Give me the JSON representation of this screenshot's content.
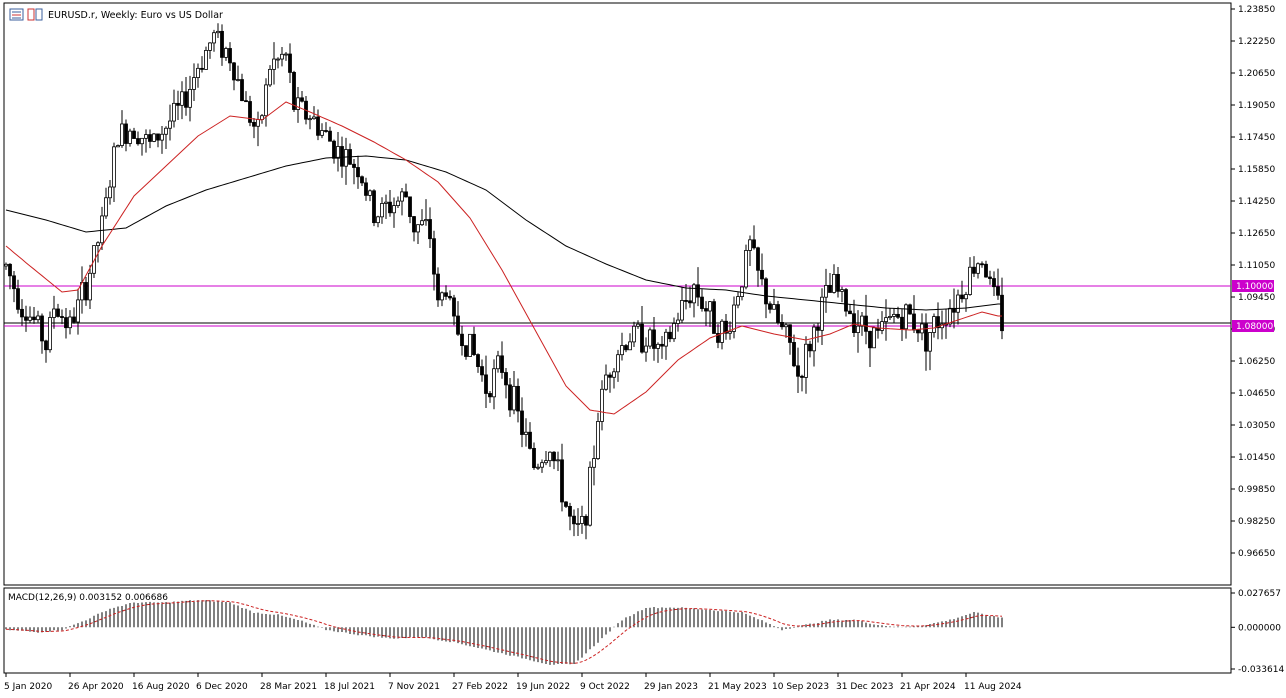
{
  "header": {
    "symbol_line": "EURUSD.r, Weekly:  Euro vs US Dollar"
  },
  "chart_data": [
    {
      "type": "candlestick",
      "title": "EURUSD.r, Weekly:  Euro vs US Dollar",
      "ylim": [
        0.955,
        1.2385
      ],
      "y_ticks": [
        "1.23850",
        "1.22250",
        "1.20650",
        "1.19050",
        "1.17450",
        "1.15850",
        "1.14250",
        "1.12650",
        "1.11050",
        "1.09450",
        "1.07850",
        "1.06250",
        "1.04650",
        "1.03050",
        "1.01450",
        "0.99850",
        "0.98250",
        "0.96650"
      ],
      "x_ticks": [
        {
          "label": "5 Jan 2020",
          "i": 0
        },
        {
          "label": "26 Apr 2020",
          "i": 16
        },
        {
          "label": "16 Aug 2020",
          "i": 32
        },
        {
          "label": "6 Dec 2020",
          "i": 48
        },
        {
          "label": "28 Mar 2021",
          "i": 64
        },
        {
          "label": "18 Jul 2021",
          "i": 80
        },
        {
          "label": "7 Nov 2021",
          "i": 96
        },
        {
          "label": "27 Feb 2022",
          "i": 112
        },
        {
          "label": "19 Jun 2022",
          "i": 128
        },
        {
          "label": "9 Oct 2022",
          "i": 144
        },
        {
          "label": "29 Jan 2023",
          "i": 160
        },
        {
          "label": "21 May 2023",
          "i": 176
        },
        {
          "label": "10 Sep 2023",
          "i": 192
        },
        {
          "label": "31 Dec 2023",
          "i": 208
        },
        {
          "label": "21 Apr 2024",
          "i": 224
        },
        {
          "label": "11 Aug 2024",
          "i": 240
        }
      ],
      "horizontal_levels": [
        {
          "value": 1.1,
          "label": "1.10000",
          "color": "#cc00cc"
        },
        {
          "value": 1.08,
          "label": "1.08000",
          "color": "#cc00cc"
        }
      ],
      "price_line": {
        "value": 1.0815,
        "color": "#000000"
      },
      "anchors": [
        [
          0,
          1.11
        ],
        [
          4,
          1.09
        ],
        [
          8,
          1.08
        ],
        [
          10,
          1.07
        ],
        [
          12,
          1.09
        ],
        [
          16,
          1.08
        ],
        [
          20,
          1.1
        ],
        [
          24,
          1.13
        ],
        [
          28,
          1.175
        ],
        [
          32,
          1.18
        ],
        [
          36,
          1.17
        ],
        [
          40,
          1.18
        ],
        [
          44,
          1.19
        ],
        [
          48,
          1.21
        ],
        [
          52,
          1.225
        ],
        [
          56,
          1.215
        ],
        [
          60,
          1.19
        ],
        [
          63,
          1.175
        ],
        [
          66,
          1.21
        ],
        [
          70,
          1.215
        ],
        [
          72,
          1.19
        ],
        [
          76,
          1.185
        ],
        [
          80,
          1.175
        ],
        [
          84,
          1.165
        ],
        [
          88,
          1.16
        ],
        [
          92,
          1.135
        ],
        [
          96,
          1.14
        ],
        [
          100,
          1.145
        ],
        [
          102,
          1.13
        ],
        [
          104,
          1.13
        ],
        [
          106,
          1.125
        ],
        [
          108,
          1.09
        ],
        [
          110,
          1.1
        ],
        [
          112,
          1.08
        ],
        [
          116,
          1.07
        ],
        [
          120,
          1.05
        ],
        [
          124,
          1.06
        ],
        [
          128,
          1.035
        ],
        [
          132,
          1.01
        ],
        [
          136,
          1.02
        ],
        [
          140,
          0.99
        ],
        [
          142,
          0.975
        ],
        [
          144,
          0.98
        ],
        [
          146,
          1.0
        ],
        [
          148,
          1.035
        ],
        [
          150,
          1.055
        ],
        [
          152,
          1.065
        ],
        [
          156,
          1.075
        ],
        [
          160,
          1.075
        ],
        [
          164,
          1.065
        ],
        [
          168,
          1.085
        ],
        [
          172,
          1.1
        ],
        [
          176,
          1.085
        ],
        [
          180,
          1.075
        ],
        [
          184,
          1.105
        ],
        [
          186,
          1.12
        ],
        [
          188,
          1.105
        ],
        [
          192,
          1.085
        ],
        [
          196,
          1.07
        ],
        [
          198,
          1.055
        ],
        [
          200,
          1.065
        ],
        [
          204,
          1.09
        ],
        [
          207,
          1.1
        ],
        [
          210,
          1.09
        ],
        [
          214,
          1.08
        ],
        [
          218,
          1.075
        ],
        [
          222,
          1.085
        ],
        [
          226,
          1.085
        ],
        [
          230,
          1.075
        ],
        [
          234,
          1.085
        ],
        [
          238,
          1.095
        ],
        [
          242,
          1.11
        ],
        [
          244,
          1.115
        ],
        [
          246,
          1.1
        ],
        [
          248,
          1.09
        ],
        [
          249,
          1.082
        ]
      ],
      "series": [
        {
          "name": "",
          "kind": "moving-average",
          "period": 200,
          "color": "#000000",
          "values": [
            [
              0,
              1.138
            ],
            [
              10,
              1.133
            ],
            [
              20,
              1.127
            ],
            [
              30,
              1.129
            ],
            [
              40,
              1.14
            ],
            [
              50,
              1.148
            ],
            [
              60,
              1.154
            ],
            [
              70,
              1.16
            ],
            [
              80,
              1.164
            ],
            [
              90,
              1.165
            ],
            [
              100,
              1.163
            ],
            [
              110,
              1.157
            ],
            [
              120,
              1.148
            ],
            [
              130,
              1.133
            ],
            [
              140,
              1.12
            ],
            [
              150,
              1.111
            ],
            [
              160,
              1.103
            ],
            [
              170,
              1.099
            ],
            [
              180,
              1.098
            ],
            [
              190,
              1.095
            ],
            [
              200,
              1.093
            ],
            [
              210,
              1.091
            ],
            [
              220,
              1.089
            ],
            [
              230,
              1.088
            ],
            [
              240,
              1.089
            ],
            [
              248,
              1.091
            ]
          ]
        },
        {
          "name": "",
          "kind": "moving-average",
          "period": 50,
          "color": "#cc2222",
          "values": [
            [
              0,
              1.12
            ],
            [
              6,
              1.11
            ],
            [
              14,
              1.097
            ],
            [
              18,
              1.098
            ],
            [
              24,
              1.12
            ],
            [
              32,
              1.145
            ],
            [
              40,
              1.16
            ],
            [
              48,
              1.175
            ],
            [
              56,
              1.185
            ],
            [
              64,
              1.183
            ],
            [
              70,
              1.192
            ],
            [
              76,
              1.187
            ],
            [
              84,
              1.18
            ],
            [
              92,
              1.172
            ],
            [
              100,
              1.163
            ],
            [
              108,
              1.152
            ],
            [
              116,
              1.134
            ],
            [
              124,
              1.108
            ],
            [
              132,
              1.079
            ],
            [
              140,
              1.05
            ],
            [
              146,
              1.038
            ],
            [
              152,
              1.036
            ],
            [
              160,
              1.047
            ],
            [
              168,
              1.063
            ],
            [
              176,
              1.074
            ],
            [
              184,
              1.08
            ],
            [
              192,
              1.076
            ],
            [
              200,
              1.073
            ],
            [
              206,
              1.076
            ],
            [
              212,
              1.081
            ],
            [
              218,
              1.079
            ],
            [
              226,
              1.078
            ],
            [
              232,
              1.079
            ],
            [
              238,
              1.083
            ],
            [
              244,
              1.087
            ],
            [
              248,
              1.085
            ]
          ]
        }
      ]
    },
    {
      "type": "histogram",
      "title": "MACD(12,26,9) 0.003152 0.006686",
      "ylim": [
        -0.03361,
        0.02765
      ],
      "y_ticks": [
        "0.027657",
        "0.000000",
        "-0.033614"
      ],
      "signal_color": "#cc2222",
      "anchors": [
        [
          0,
          -0.002
        ],
        [
          8,
          -0.004
        ],
        [
          14,
          -0.002
        ],
        [
          20,
          0.006
        ],
        [
          26,
          0.015
        ],
        [
          32,
          0.02
        ],
        [
          40,
          0.02
        ],
        [
          48,
          0.022
        ],
        [
          56,
          0.02
        ],
        [
          62,
          0.012
        ],
        [
          68,
          0.01
        ],
        [
          74,
          0.005
        ],
        [
          80,
          -0.002
        ],
        [
          88,
          -0.006
        ],
        [
          96,
          -0.009
        ],
        [
          104,
          -0.008
        ],
        [
          112,
          -0.012
        ],
        [
          120,
          -0.018
        ],
        [
          128,
          -0.024
        ],
        [
          136,
          -0.03
        ],
        [
          142,
          -0.03
        ],
        [
          148,
          -0.012
        ],
        [
          154,
          0.006
        ],
        [
          160,
          0.016
        ],
        [
          168,
          0.016
        ],
        [
          176,
          0.014
        ],
        [
          184,
          0.012
        ],
        [
          190,
          0.004
        ],
        [
          194,
          -0.002
        ],
        [
          200,
          0.002
        ],
        [
          206,
          0.006
        ],
        [
          212,
          0.006
        ],
        [
          218,
          0.002
        ],
        [
          224,
          0.0
        ],
        [
          230,
          0.002
        ],
        [
          236,
          0.006
        ],
        [
          242,
          0.012
        ],
        [
          248,
          0.008
        ]
      ]
    }
  ]
}
